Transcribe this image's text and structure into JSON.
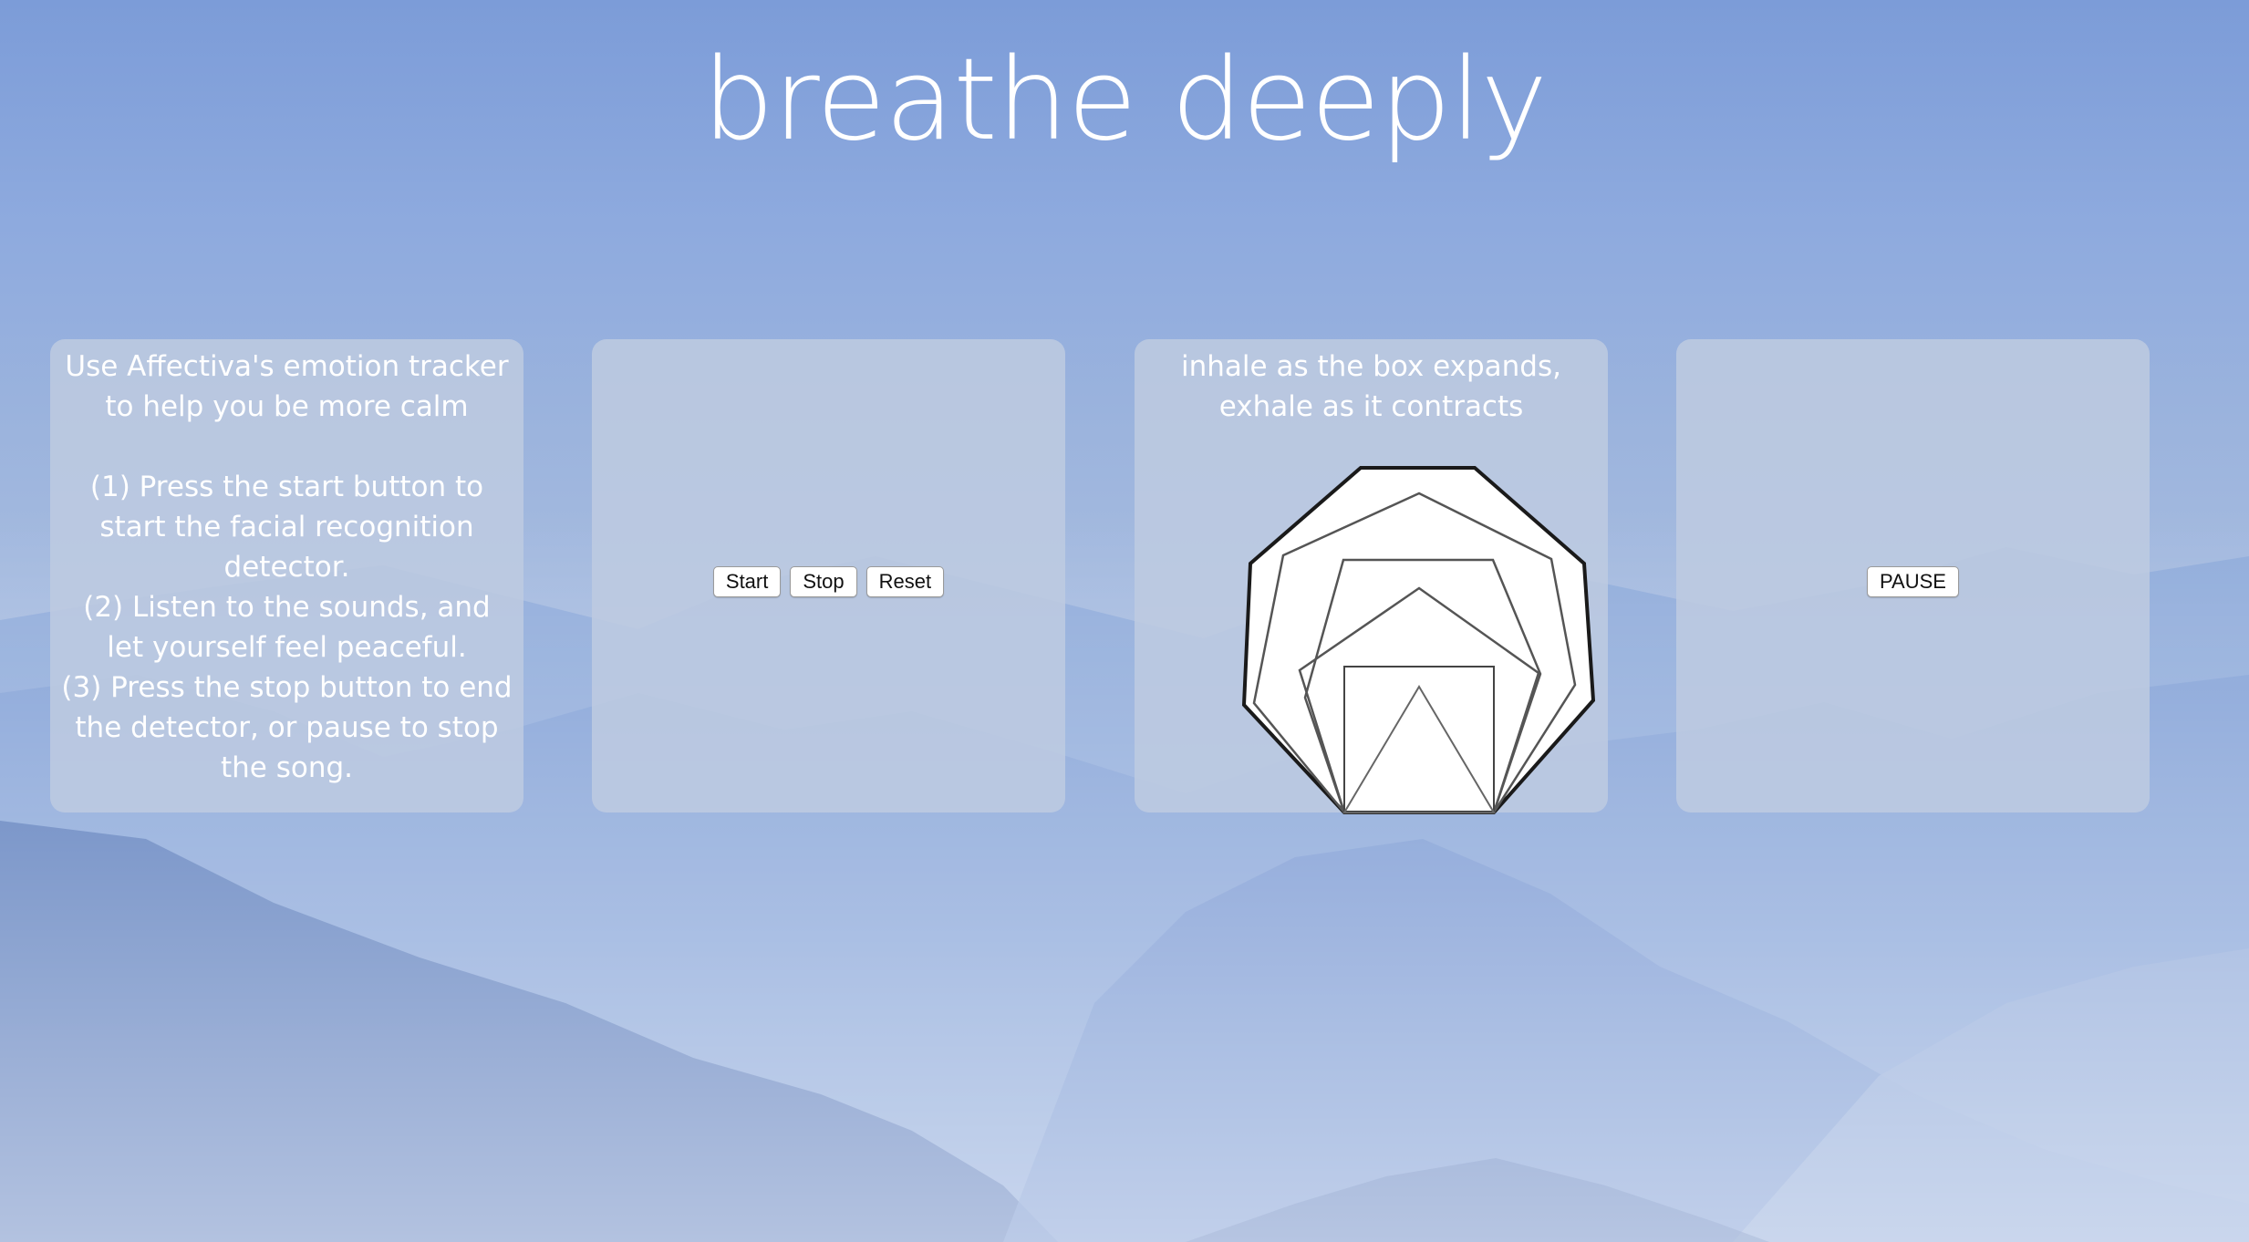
{
  "page": {
    "title": "breathe deeply"
  },
  "instructions": {
    "text": "Use Affectiva's emotion tracker to help you be more calm\n\n(1) Press the start button to start the facial recognition detector.\n(2) Listen to the sounds, and let yourself feel peaceful.\n(3) Press the stop button to end the detector, or pause to stop the song."
  },
  "controls": {
    "start_label": "Start",
    "stop_label": "Stop",
    "reset_label": "Reset"
  },
  "breathing": {
    "prompt": "inhale as the box expands,\nexhale as it contracts"
  },
  "music": {
    "pause_label": "PAUSE"
  },
  "colors": {
    "panel": "#becbe1",
    "text": "#ffffff",
    "sky_top": "#7c9cd8",
    "mountain_dark": "#4f73b8"
  }
}
